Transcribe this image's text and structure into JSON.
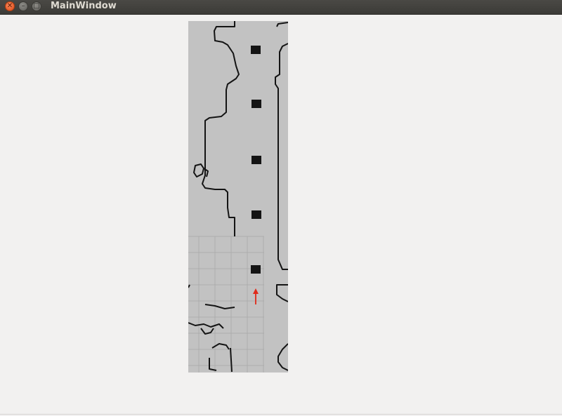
{
  "window": {
    "title": "MainWindow",
    "controls": {
      "close_glyph": "✕",
      "minimize_glyph": "–",
      "maximize_glyph": "□"
    }
  },
  "map": {
    "kind": "occupancy grid map",
    "colors": {
      "free_space": "#c2c2c2",
      "walls": "#141414",
      "grid": "#a9a9a9",
      "robot_arrow": "#e02a1a"
    },
    "pillar_count": 5
  }
}
